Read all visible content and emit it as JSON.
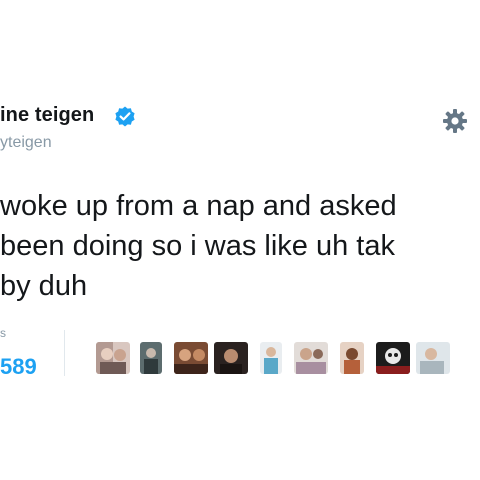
{
  "tweet": {
    "display_name": "ine teigen",
    "handle": "yteigen",
    "text_lines": [
      "woke up from a nap and asked",
      "been doing so i was like uh tak",
      "by duh"
    ],
    "stat_label": "s",
    "stat_count": "589"
  },
  "icons": {
    "verified": "verified-badge-icon",
    "settings": "gear-icon"
  },
  "colors": {
    "link_blue": "#1da1f2",
    "verified_blue": "#1da1f2",
    "text": "#14171a",
    "secondary_text": "#8899a6"
  }
}
